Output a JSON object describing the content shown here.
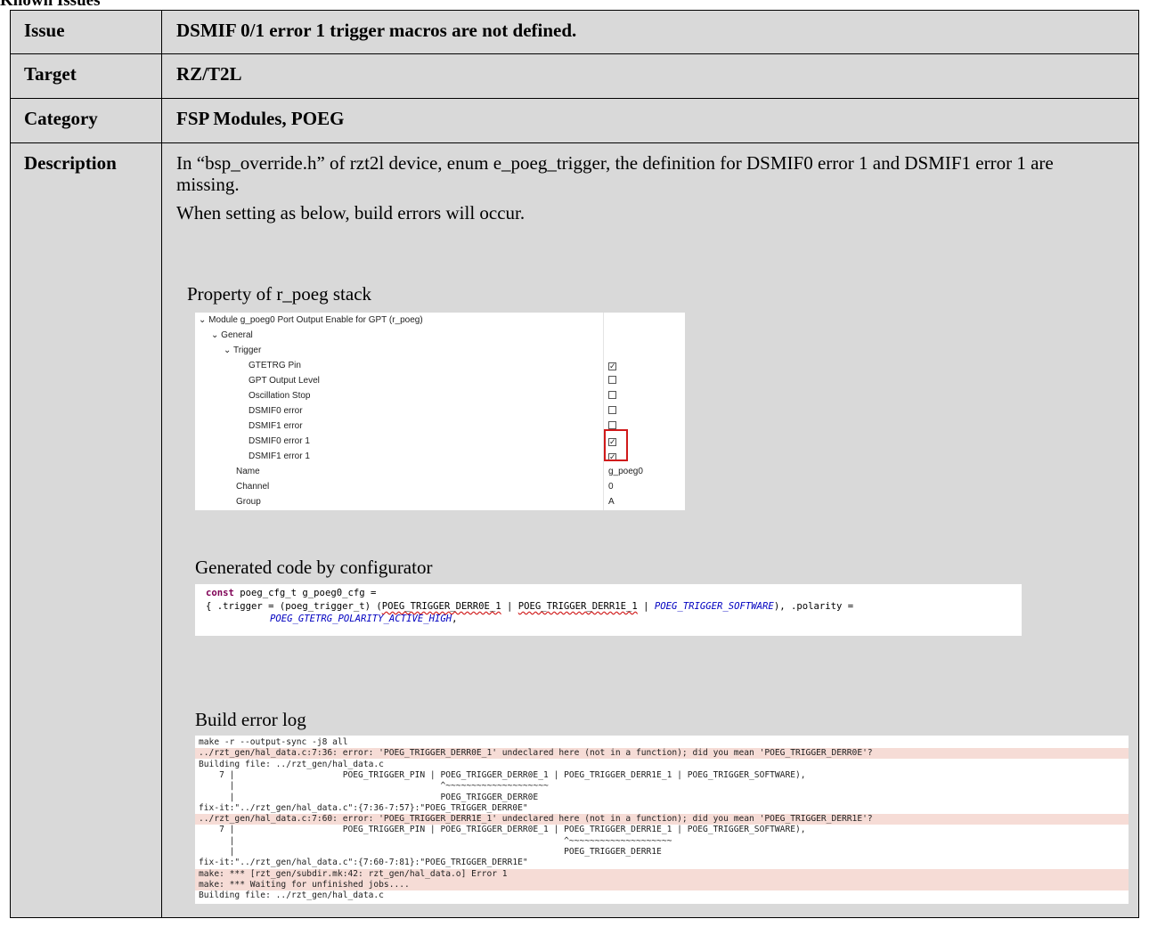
{
  "cut_top_text": "Known Issues",
  "rows": {
    "issue": {
      "label": "Issue",
      "value": "DSMIF 0/1 error 1 trigger macros are not defined."
    },
    "target": {
      "label": "Target",
      "value": "RZ/T2L"
    },
    "category": {
      "label": "Category",
      "value": "FSP Modules, POEG"
    },
    "description": {
      "label": "Description",
      "para1": "In “bsp_override.h” of rzt2l device, enum e_poeg_trigger, the definition for DSMIF0 error 1 and DSMIF1 error 1 are missing.",
      "para2": "When setting as below, build errors will occur.",
      "property_caption": "Property of r_poeg stack",
      "code_caption": "Generated code by configurator",
      "log_caption": "Build error log"
    }
  },
  "property": {
    "module": "Module g_poeg0 Port Output Enable for GPT (r_poeg)",
    "general": "General",
    "trigger": "Trigger",
    "items": [
      {
        "label": "GTETRG Pin",
        "checked": true
      },
      {
        "label": "GPT Output Level",
        "checked": false
      },
      {
        "label": "Oscillation Stop",
        "checked": false
      },
      {
        "label": "DSMIF0 error",
        "checked": false
      },
      {
        "label": "DSMIF1 error",
        "checked": false
      },
      {
        "label": "DSMIF0 error 1",
        "checked": true
      },
      {
        "label": "DSMIF1 error 1",
        "checked": true
      }
    ],
    "name": {
      "key": "Name",
      "value": "g_poeg0"
    },
    "channel": {
      "key": "Channel",
      "value": "0"
    },
    "group": {
      "key": "Group",
      "value": "A"
    }
  },
  "code": {
    "l1_kw": "const",
    "l1_rest": " poeg_cfg_t g_poeg0_cfg =",
    "l2_a": "{ .trigger = (poeg_trigger_t) (",
    "l2_e1": "POEG_TRIGGER_DERR0E_1",
    "l2_b": " | ",
    "l2_e2": "POEG_TRIGGER_DERR1E_1",
    "l2_c": " | ",
    "l2_m": "POEG_TRIGGER_SOFTWARE",
    "l2_d": "), .polarity =",
    "l3_m": "POEG_GTETRG_POLARITY_ACTIVE_HIGH",
    "l3_d": ","
  },
  "log": [
    {
      "text": "make -r --output-sync -j8 all",
      "error": false
    },
    {
      "text": "../rzt_gen/hal_data.c:7:36: error: 'POEG_TRIGGER_DERR0E_1' undeclared here (not in a function); did you mean 'POEG_TRIGGER_DERR0E'?",
      "error": true
    },
    {
      "text": "Building file: ../rzt_gen/hal_data.c",
      "error": false
    },
    {
      "text": "    7 |                     POEG_TRIGGER_PIN | POEG_TRIGGER_DERR0E_1 | POEG_TRIGGER_DERR1E_1 | POEG_TRIGGER_SOFTWARE),",
      "error": false
    },
    {
      "text": "      |                                        ^~~~~~~~~~~~~~~~~~~~~",
      "error": false
    },
    {
      "text": "      |                                        POEG_TRIGGER_DERR0E",
      "error": false
    },
    {
      "text": "fix-it:\"../rzt_gen/hal_data.c\":{7:36-7:57}:\"POEG_TRIGGER_DERR0E\"",
      "error": false
    },
    {
      "text": "../rzt_gen/hal_data.c:7:60: error: 'POEG_TRIGGER_DERR1E_1' undeclared here (not in a function); did you mean 'POEG_TRIGGER_DERR1E'?",
      "error": true
    },
    {
      "text": "    7 |                     POEG_TRIGGER_PIN | POEG_TRIGGER_DERR0E_1 | POEG_TRIGGER_DERR1E_1 | POEG_TRIGGER_SOFTWARE),",
      "error": false
    },
    {
      "text": "      |                                                                ^~~~~~~~~~~~~~~~~~~~~",
      "error": false
    },
    {
      "text": "      |                                                                POEG_TRIGGER_DERR1E",
      "error": false
    },
    {
      "text": "fix-it:\"../rzt_gen/hal_data.c\":{7:60-7:81}:\"POEG_TRIGGER_DERR1E\"",
      "error": false
    },
    {
      "text": "make: *** [rzt_gen/subdir.mk:42: rzt_gen/hal_data.o] Error 1",
      "error": true
    },
    {
      "text": "make: *** Waiting for unfinished jobs....",
      "error": true
    },
    {
      "text": "Building file: ../rzt_gen/hal_data.c",
      "error": false
    }
  ]
}
